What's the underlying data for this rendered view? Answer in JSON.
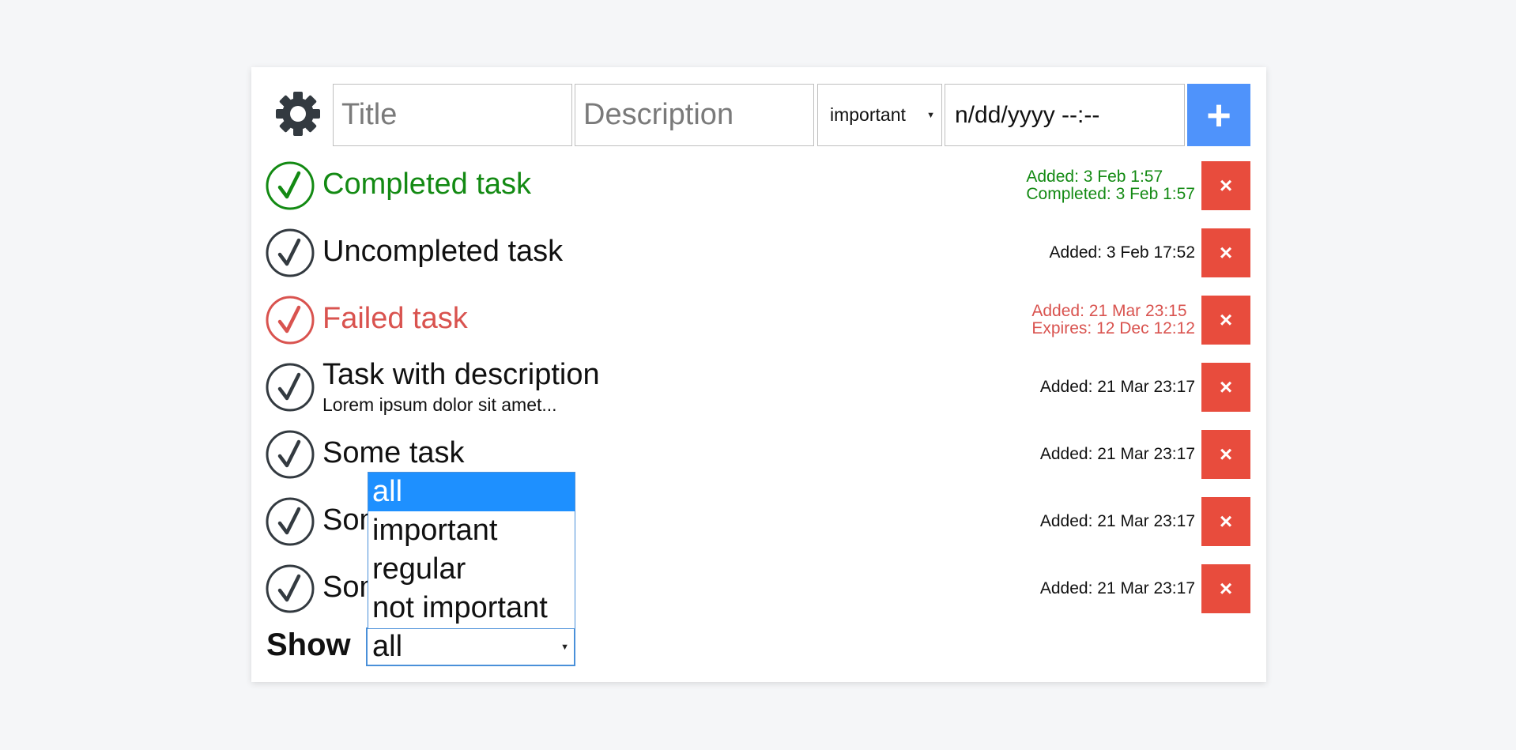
{
  "form": {
    "title_placeholder": "Title",
    "description_placeholder": "Description",
    "priority_value": "important",
    "date_value": "n/dd/yyyy --:--",
    "add_label": "+"
  },
  "tasks": [
    {
      "title": "Completed task",
      "description": "",
      "status": "completed",
      "meta": [
        "Added: 3 Feb 1:57",
        "Completed: 3 Feb 1:57"
      ]
    },
    {
      "title": "Uncompleted task",
      "description": "",
      "status": "normal",
      "meta": [
        "Added: 3 Feb 17:52"
      ]
    },
    {
      "title": "Failed task",
      "description": "",
      "status": "failed",
      "meta": [
        "Added: 21 Mar 23:15",
        "Expires: 12 Dec 12:12"
      ]
    },
    {
      "title": "Task with description",
      "description": "Lorem ipsum dolor sit amet...",
      "status": "normal",
      "meta": [
        "Added: 21 Mar 23:17"
      ]
    },
    {
      "title": "Some task",
      "description": "",
      "status": "normal",
      "meta": [
        "Added: 21 Mar 23:17"
      ]
    },
    {
      "title": "Some task",
      "description": "",
      "status": "normal",
      "meta": [
        "Added: 21 Mar 23:17"
      ]
    },
    {
      "title": "Some task",
      "description": "",
      "status": "normal",
      "meta": [
        "Added: 21 Mar 23:17"
      ]
    }
  ],
  "delete_label": "×",
  "filter": {
    "label": "Show",
    "selected": "all",
    "options": [
      "all",
      "important",
      "regular",
      "not important"
    ]
  },
  "colors": {
    "completed": "#138a13",
    "failed": "#d9534f",
    "normal": "#333a40",
    "add_button": "#4f93fb",
    "delete_button": "#e84c3d",
    "dropdown_highlight": "#1e90ff"
  },
  "icons": {
    "settings": "gear-icon",
    "check": "check-circle-icon",
    "delete": "close-icon",
    "add": "plus-icon"
  }
}
